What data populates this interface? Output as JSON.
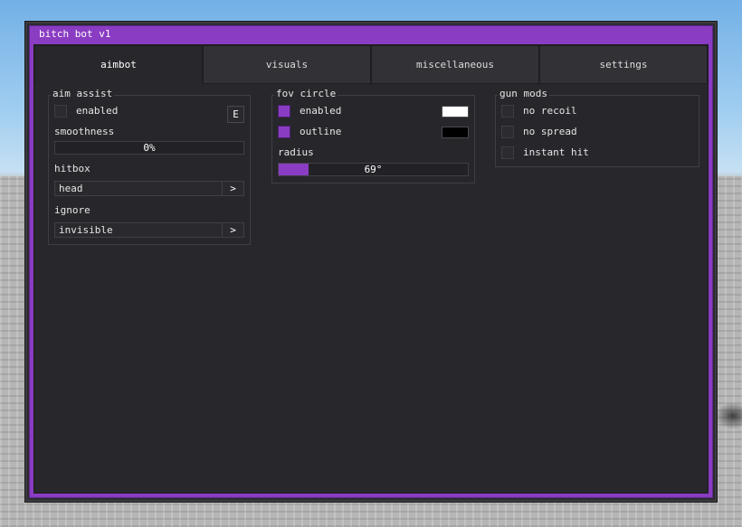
{
  "window": {
    "title": "bitch bot v1"
  },
  "tabs": [
    {
      "label": "aimbot",
      "active": true
    },
    {
      "label": "visuals",
      "active": false
    },
    {
      "label": "miscellaneous",
      "active": false
    },
    {
      "label": "settings",
      "active": false
    }
  ],
  "aim_assist": {
    "title": "aim assist",
    "enabled": {
      "label": "enabled",
      "checked": false,
      "keybind": "E"
    },
    "smoothness": {
      "label": "smoothness",
      "value_text": "0%",
      "fraction": 0.0
    },
    "hitbox": {
      "label": "hitbox",
      "value": "head",
      "arrow": ">"
    },
    "ignore": {
      "label": "ignore",
      "value": "invisible",
      "arrow": ">"
    }
  },
  "fov_circle": {
    "title": "fov circle",
    "enabled": {
      "label": "enabled",
      "checked": true,
      "color": "#ffffff"
    },
    "outline": {
      "label": "outline",
      "checked": true,
      "color": "#000000"
    },
    "radius": {
      "label": "radius",
      "value_text": "69°",
      "fraction": 0.16
    }
  },
  "gun_mods": {
    "title": "gun mods",
    "items": [
      {
        "label": "no recoil",
        "checked": false
      },
      {
        "label": "no spread",
        "checked": false
      },
      {
        "label": "instant hit",
        "checked": false
      }
    ]
  },
  "colors": {
    "accent": "#8a3cc2",
    "panel": "#28282c",
    "sky": "#9fcdf0",
    "ground": "#b6b6b6"
  }
}
